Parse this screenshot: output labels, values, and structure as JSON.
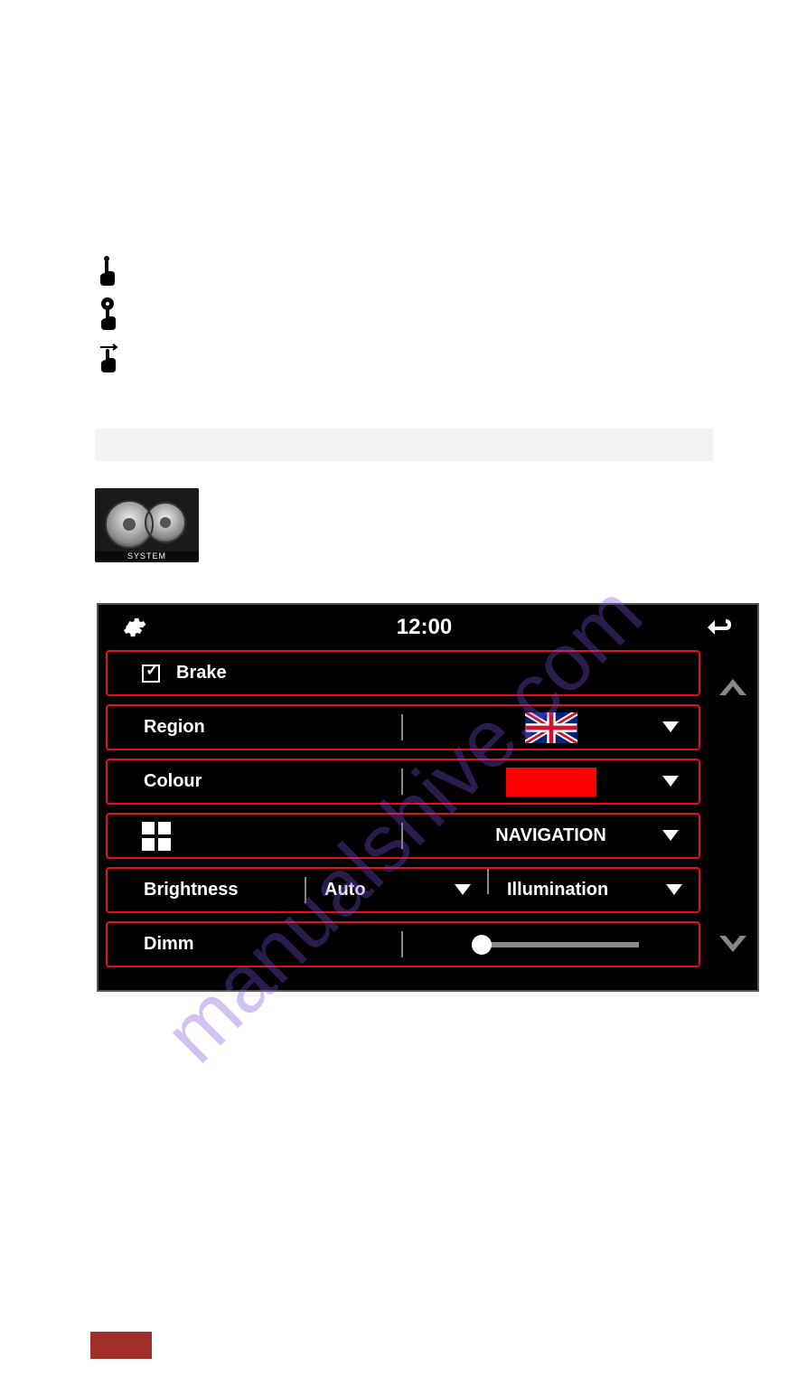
{
  "watermark": "manualshive.com",
  "gear_tile": {
    "label": "SYSTEM"
  },
  "ui": {
    "clock": "12:00",
    "rows": {
      "brake": {
        "label": "Brake",
        "checked": true
      },
      "region": {
        "label": "Region",
        "value_icon": "flag-uk"
      },
      "colour": {
        "label": "Colour",
        "value_hex": "#ff0000"
      },
      "mode": {
        "icon": "grid-icon",
        "value": "NAVIGATION"
      },
      "brightness": {
        "label": "Brightness",
        "mode": "Auto",
        "illum_label": "Illumination"
      },
      "dimm": {
        "label": "Dimm",
        "slider_value": 0
      }
    }
  }
}
